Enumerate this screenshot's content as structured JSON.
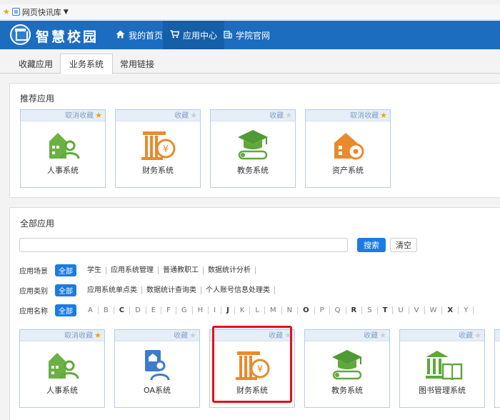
{
  "favorites": {
    "label": "网页快讯库"
  },
  "header": {
    "logo_text": "智慧校园",
    "nav": [
      {
        "label": "我的首页",
        "icon": "home-icon"
      },
      {
        "label": "应用中心",
        "icon": "cart-icon",
        "active": true
      },
      {
        "label": "学院官网",
        "icon": "building-icon"
      }
    ]
  },
  "tabs": [
    "收藏应用",
    "业务系统",
    "常用链接"
  ],
  "recommended": {
    "title": "推荐应用",
    "cards": [
      {
        "fav": "取消收藏",
        "starred": true,
        "name": "人事系统",
        "icon": "personnel-icon"
      },
      {
        "fav": "收藏",
        "starred": false,
        "name": "财务系统",
        "icon": "finance-icon"
      },
      {
        "fav": "收藏",
        "starred": false,
        "name": "教务系统",
        "icon": "academic-icon"
      },
      {
        "fav": "取消收藏",
        "starred": true,
        "name": "资产系统",
        "icon": "asset-icon"
      }
    ]
  },
  "all_apps": {
    "title": "全部应用",
    "search_button": "搜索",
    "clear_button": "清空",
    "filters": {
      "scene": {
        "label": "应用场景",
        "all": "全部",
        "options": [
          "学生",
          "应用系统管理",
          "普通教职工",
          "数据统计分析"
        ]
      },
      "category": {
        "label": "应用类别",
        "all": "全部",
        "options": [
          "应用系统单点类",
          "数据统计查询类",
          "个人账号信息处理类"
        ]
      },
      "name": {
        "label": "应用名称",
        "all": "全部",
        "letters": [
          "A",
          "B",
          "C",
          "D",
          "E",
          "F",
          "G",
          "H",
          "I",
          "J",
          "K",
          "L",
          "M",
          "N",
          "O",
          "P",
          "Q",
          "R",
          "S",
          "T",
          "U",
          "V",
          "W",
          "X",
          "Y"
        ],
        "bold_letters": [
          "C",
          "J",
          "O",
          "R",
          "T",
          "X"
        ]
      }
    },
    "cards": [
      {
        "fav": "取消收藏",
        "starred": true,
        "name": "人事系统",
        "icon": "personnel-icon"
      },
      {
        "fav": "收藏",
        "starred": false,
        "name": "OA系统",
        "icon": "oa-icon"
      },
      {
        "fav": "收藏",
        "starred": false,
        "name": "财务系统",
        "icon": "finance-icon",
        "highlighted": true
      },
      {
        "fav": "收藏",
        "starred": false,
        "name": "教务系统",
        "icon": "academic-icon"
      },
      {
        "fav": "收藏",
        "starred": false,
        "name": "图书管理系统",
        "icon": "library-icon"
      }
    ]
  },
  "colors": {
    "header": "#1c6cc0",
    "accent": "#1c7be0",
    "highlight": "#e0111b",
    "icon_green": "#5fa83a",
    "icon_orange": "#e98a2c"
  }
}
